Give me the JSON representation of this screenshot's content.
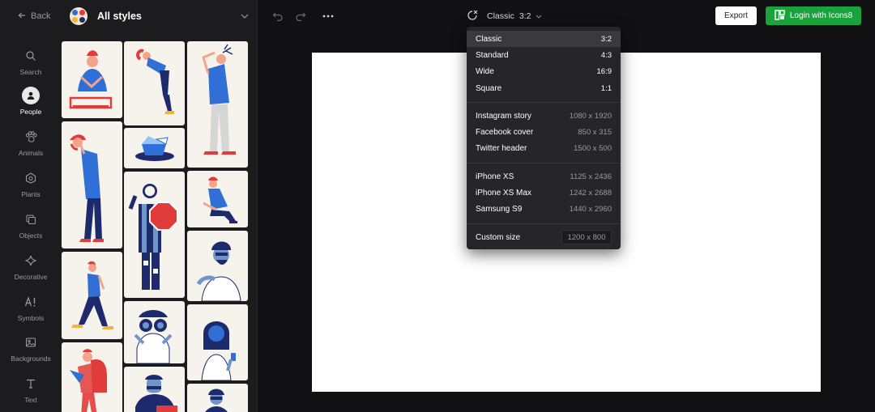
{
  "nav": {
    "back_label": "Back",
    "style_title": "All styles"
  },
  "sidebar": {
    "items": [
      {
        "label": "Search",
        "icon": "search-icon"
      },
      {
        "label": "People",
        "icon": "person-icon",
        "active": true
      },
      {
        "label": "Animals",
        "icon": "paw-icon"
      },
      {
        "label": "Plants",
        "icon": "plant-icon"
      },
      {
        "label": "Objects",
        "icon": "objects-icon"
      },
      {
        "label": "Decorative",
        "icon": "sparkle-icon"
      },
      {
        "label": "Symbols",
        "icon": "symbols-icon"
      },
      {
        "label": "Backgrounds",
        "icon": "image-icon"
      },
      {
        "label": "Text",
        "icon": "text-icon"
      }
    ]
  },
  "toolbar": {
    "format_name": "Classic",
    "format_ratio": "3:2",
    "export_label": "Export",
    "login_label": "Login with Icons8"
  },
  "dropdown": {
    "group1": [
      {
        "name": "Classic",
        "value": "3:2",
        "selected": true
      },
      {
        "name": "Standard",
        "value": "4:3"
      },
      {
        "name": "Wide",
        "value": "16:9"
      },
      {
        "name": "Square",
        "value": "1:1"
      }
    ],
    "group2": [
      {
        "name": "Instagram story",
        "value": "1080 x 1920"
      },
      {
        "name": "Facebook cover",
        "value": "850 x 315"
      },
      {
        "name": "Twitter header",
        "value": "1500 x 500"
      }
    ],
    "group3": [
      {
        "name": "iPhone XS",
        "value": "1125 x 2436"
      },
      {
        "name": "iPhone XS Max",
        "value": "1242 x 2688"
      },
      {
        "name": "Samsung S9",
        "value": "1440 x 2960"
      }
    ],
    "custom": {
      "name": "Custom size",
      "value": "1200 x 800"
    }
  },
  "colors": {
    "accent_green": "#1aa33c",
    "figure_blue": "#2f6fd6",
    "figure_navy": "#1d2a6b",
    "figure_red": "#e23b3b",
    "tile_bg": "#f6f3ec"
  }
}
